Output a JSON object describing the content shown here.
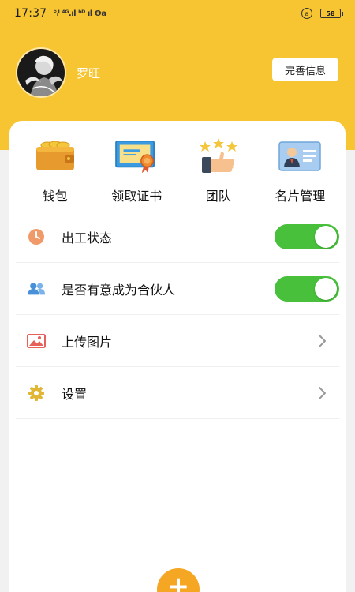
{
  "status_bar": {
    "time": "17:37",
    "network": "°ᵢᴵ ⁴ᴳ.ıl ʰᴰ ıl Ꝋa",
    "lock": "a",
    "battery": "58"
  },
  "profile": {
    "name": "罗旺",
    "complete_info_label": "完善信息"
  },
  "quick_actions": [
    {
      "label": "钱包",
      "icon": "wallet-icon"
    },
    {
      "label": "领取证书",
      "icon": "certificate-icon"
    },
    {
      "label": "团队",
      "icon": "team-icon"
    },
    {
      "label": "名片管理",
      "icon": "business-card-icon"
    }
  ],
  "menu": [
    {
      "label": "出工状态",
      "icon": "clock-icon",
      "control": "toggle",
      "on": true
    },
    {
      "label": "是否有意成为合伙人",
      "icon": "people-icon",
      "control": "toggle",
      "on": true
    },
    {
      "label": "上传图片",
      "icon": "image-icon",
      "control": "chevron"
    },
    {
      "label": "设置",
      "icon": "settings-icon",
      "control": "chevron"
    }
  ],
  "colors": {
    "header": "#f7c531",
    "toggle_on": "#48c03b",
    "fab": "#f5a623"
  },
  "fab": {
    "icon": "plus-icon",
    "label": "+"
  }
}
